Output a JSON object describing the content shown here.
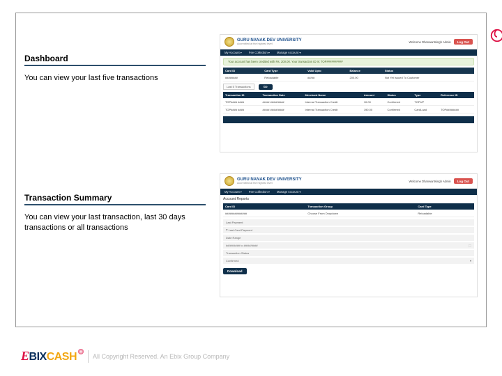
{
  "side_decoration": "decorative-swirl",
  "sections": {
    "dashboard": {
      "title": "Dashboard",
      "desc": "You can view your last five transactions"
    },
    "txsummary": {
      "title": "Transaction Summary",
      "desc": "You can view your last transaction, last 30 days transactions or all transactions"
    }
  },
  "uni": {
    "name": "GURU NANAK DEV UNIVERSITY",
    "tagline": "Accredited at the highest level"
  },
  "welcome1": "Welcome Dhanwantsingh Admin",
  "welcome2": "Welcome Dhanwantsingh Admin",
  "logout_label": "Log Out",
  "nav": {
    "i1": "My Account ▾",
    "i2": "Fee Collection ▾",
    "i3": "Manage Account ▾"
  },
  "notice": "Your account has been credited with Rs. 200.00. Your transaction ID is: TOP##########",
  "dash_cols": {
    "c1": "Card ID",
    "c2": "Card Type",
    "c3": "Valid Upto",
    "c4": "Balance",
    "c5": "Status"
  },
  "dash_row": {
    "c1": "########",
    "c2": "Reloadable",
    "c3": "##/##",
    "c4": "200.00",
    "c5": "Not Yet Issued To Customer"
  },
  "filter": {
    "opt1": "Last 5 Transactions",
    "go": "Go"
  },
  "tx_cols": {
    "c1": "Transaction ID",
    "c2": "Transaction Date",
    "c3": "Merchant Name",
    "c4": "Amount",
    "c5": "Status",
    "c6": "Type",
    "c7": "Reference ID"
  },
  "tx_rows": [
    {
      "c1": "TOP#### ####",
      "c2": "##:##   ##/##/####",
      "c3": "Internal Transaction Credit",
      "c4": "10.00",
      "c5": "Confirmed",
      "c6": "TOPUP",
      "c7": ""
    },
    {
      "c1": "TOP#### ####",
      "c2": "##:##   ##/##/####",
      "c3": "Internal Transaction Credit",
      "c4": "190.00",
      "c5": "Confirmed",
      "c6": "CardLoad",
      "c7": "TOP########"
    }
  ],
  "report": {
    "heading": "Account Reports",
    "cols": {
      "c1": "Card ID",
      "c2": "Transaction Group",
      "c3": "Card Type"
    },
    "row": {
      "c1": "##############",
      "c2": "Choose From Dropdown",
      "c3": "Reloadable"
    },
    "last_label": "Last Payment",
    "last_val": "₹ Last Card Payment",
    "date_label": "Date Range",
    "date_val1": "##/##/####",
    "date_val2": "##/##/####",
    "to": "to",
    "status_label": "Transaction Status",
    "status_val": "Confirmed",
    "download": "Download"
  },
  "footer": {
    "logo_e": "E",
    "logo_bix": "BIX",
    "logo_cash": "CASH",
    "copyright": "All Copyright Reserved. An Ebix Group Company"
  }
}
